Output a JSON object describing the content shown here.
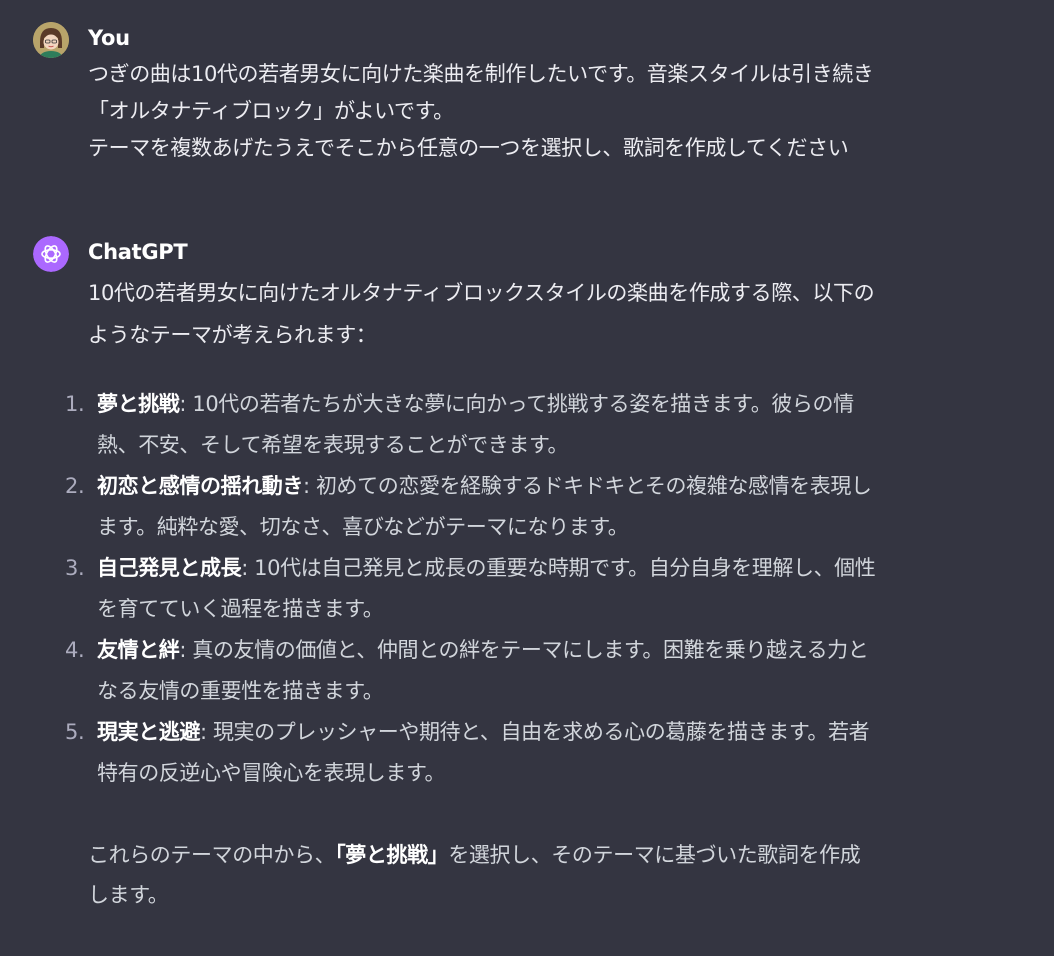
{
  "colors": {
    "background": "#343541",
    "text": "#ececf1",
    "bold_text": "#ffffff",
    "assistant_avatar_bg": "#ab68ff"
  },
  "user_message": {
    "author": "You",
    "lines": [
      "つぎの曲は10代の若者男女に向けた楽曲を制作したいです。音楽スタイルは引き続き",
      "「オルタナティブロック」がよいです。",
      "テーマを複数あげたうえでそこから任意の一つを選択し、歌詞を作成してください"
    ]
  },
  "assistant_message": {
    "author": "ChatGPT",
    "avatar_icon": "openai-logo-icon",
    "intro_lines": [
      "10代の若者男女に向けたオルタナティブロックスタイルの楽曲を作成する際、以下の",
      "ようなテーマが考えられます："
    ],
    "themes": [
      {
        "number": "1.",
        "title": "夢と挑戦",
        "line1": ": 10代の若者たちが大きな夢に向かって挑戦する姿を描きます。彼らの情",
        "line2": "熱、不安、そして希望を表現することができます。"
      },
      {
        "number": "2.",
        "title": "初恋と感情の揺れ動き",
        "line1": ": 初めての恋愛を経験するドキドキとその複雑な感情を表現し",
        "line2": "ます。純粋な愛、切なさ、喜びなどがテーマになります。"
      },
      {
        "number": "3.",
        "title": "自己発見と成長",
        "line1": ": 10代は自己発見と成長の重要な時期です。自分自身を理解し、個性",
        "line2": "を育てていく過程を描きます。"
      },
      {
        "number": "4.",
        "title": "友情と絆",
        "line1": ": 真の友情の価値と、仲間との絆をテーマにします。困難を乗り越える力と",
        "line2": "なる友情の重要性を描きます。"
      },
      {
        "number": "5.",
        "title": "現実と逃避",
        "line1": ": 現実のプレッシャーや期待と、自由を求める心の葛藤を描きます。若者",
        "line2": "特有の反逆心や冒険心を表現します。"
      }
    ],
    "closing": {
      "before": "これらのテーマの中から、",
      "highlight": "「夢と挑戦」",
      "after": "を選択し、そのテーマに基づいた歌詞を作成",
      "line2": "します。"
    }
  }
}
